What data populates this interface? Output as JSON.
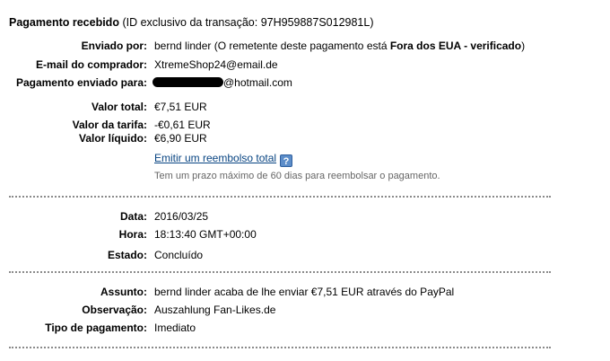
{
  "header": {
    "title": "Pagamento recebido",
    "transaction_prefix": "(ID exclusivo da transação: ",
    "transaction_id": "97H959887S012981L",
    "transaction_suffix": ")"
  },
  "sender": {
    "label": "Enviado por:",
    "name": "bernd linder",
    "note_prefix": "(O remetente deste pagamento está ",
    "note_bold": "Fora dos EUA - verificado",
    "note_suffix": ")"
  },
  "buyer_email": {
    "label": "E-mail do comprador:",
    "value": "XtremeShop24@email.de"
  },
  "sent_to": {
    "label": "Pagamento enviado para:",
    "value_suffix": "@hotmail.com"
  },
  "amounts": {
    "total_label": "Valor total:",
    "total_value": "€7,51 EUR",
    "fee_label": "Valor da tarifa:",
    "fee_value": "-€0,61 EUR",
    "net_label": "Valor líquido:",
    "net_value": "€6,90 EUR"
  },
  "refund": {
    "link": "Emitir um reembolso total",
    "help_icon": "?",
    "note": "Tem um prazo máximo de 60 dias para reembolsar o pagamento."
  },
  "details": {
    "date_label": "Data:",
    "date_value": "2016/03/25",
    "time_label": "Hora:",
    "time_value": "18:13:40 GMT+00:00",
    "status_label": "Estado:",
    "status_value": "Concluído"
  },
  "message": {
    "subject_label": "Assunto:",
    "subject_value": "bernd linder acaba de lhe enviar €7,51 EUR através do PayPal",
    "note_label": "Observação:",
    "note_value": "Auszahlung Fan-Likes.de",
    "type_label": "Tipo de pagamento:",
    "type_value": "Imediato"
  }
}
